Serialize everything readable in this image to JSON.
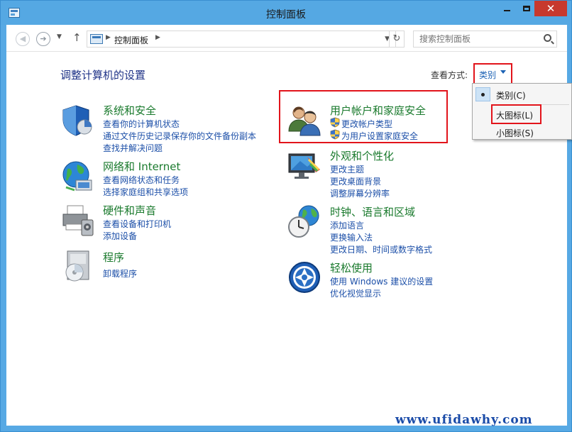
{
  "window": {
    "title": "控制面板",
    "min_icon": "minimize-icon",
    "max_icon": "maximize-icon",
    "close_label": "✕"
  },
  "address": {
    "crumb": "控制面板",
    "search_placeholder": "搜索控制面板"
  },
  "header": {
    "page_title": "调整计算机的设置",
    "view_by_label": "查看方式:",
    "view_by_value": "类别"
  },
  "view_menu": {
    "items": [
      {
        "label": "类别(C)",
        "selected": true
      },
      {
        "label": "大图标(L)",
        "selected": false
      },
      {
        "label": "小图标(S)",
        "selected": false
      }
    ]
  },
  "categories": {
    "system": {
      "title": "系统和安全",
      "icon": "shield-icon",
      "links": [
        "查看你的计算机状态",
        "通过文件历史记录保存你的文件备份副本",
        "查找并解决问题"
      ]
    },
    "network": {
      "title": "网络和 Internet",
      "icon": "globe-network-icon",
      "links": [
        "查看网络状态和任务",
        "选择家庭组和共享选项"
      ]
    },
    "hardware": {
      "title": "硬件和声音",
      "icon": "printer-icon",
      "links": [
        "查看设备和打印机",
        "添加设备"
      ]
    },
    "programs": {
      "title": "程序",
      "icon": "programs-icon",
      "links": [
        "卸载程序"
      ]
    },
    "users": {
      "title": "用户帐户和家庭安全",
      "icon": "users-icon",
      "links": [
        "更改帐户类型",
        "为用户设置家庭安全"
      ]
    },
    "appearance": {
      "title": "外观和个性化",
      "icon": "appearance-icon",
      "links": [
        "更改主题",
        "更改桌面背景",
        "调整屏幕分辨率"
      ]
    },
    "clock": {
      "title": "时钟、语言和区域",
      "icon": "clock-globe-icon",
      "links": [
        "添加语言",
        "更换输入法",
        "更改日期、时间或数字格式"
      ]
    },
    "ease": {
      "title": "轻松使用",
      "icon": "ease-of-access-icon",
      "links": [
        "使用 Windows 建议的设置",
        "优化视觉显示"
      ]
    }
  },
  "watermark": "www.ufidawhy.com",
  "colors": {
    "title_bar": "#55a8e3",
    "close_button": "#c7392e",
    "category_title": "#1a7a2d",
    "link": "#1c4fa8",
    "highlight_box": "#e2141b"
  }
}
